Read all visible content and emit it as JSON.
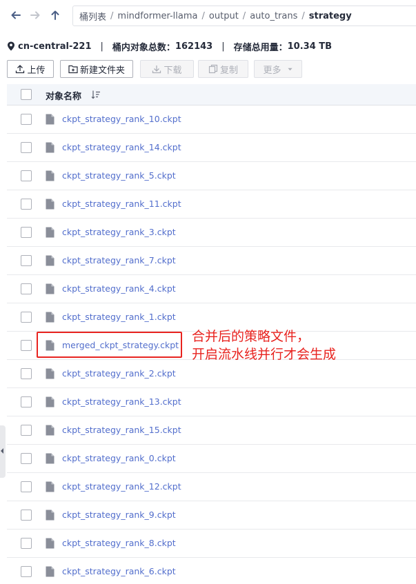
{
  "nav": {
    "back_icon": "arrow-left-icon",
    "forward_icon": "arrow-right-icon",
    "up_icon": "arrow-up-icon",
    "breadcrumbs": [
      "桶列表",
      "mindformer-llama",
      "output",
      "auto_trans",
      "strategy"
    ]
  },
  "info": {
    "region": "cn-central-221",
    "object_count_label": "桶内对象总数：",
    "object_count": "162143",
    "storage_label": "存储总用量：",
    "storage": "10.34 TB"
  },
  "toolbar": {
    "upload": "上传",
    "new_folder": "新建文件夹",
    "download": "下载",
    "copy": "复制",
    "more": "更多"
  },
  "table": {
    "header_name": "对象名称",
    "rows": [
      "ckpt_strategy_rank_10.ckpt",
      "ckpt_strategy_rank_14.ckpt",
      "ckpt_strategy_rank_5.ckpt",
      "ckpt_strategy_rank_11.ckpt",
      "ckpt_strategy_rank_3.ckpt",
      "ckpt_strategy_rank_7.ckpt",
      "ckpt_strategy_rank_4.ckpt",
      "ckpt_strategy_rank_1.ckpt",
      "merged_ckpt_strategy.ckpt",
      "ckpt_strategy_rank_2.ckpt",
      "ckpt_strategy_rank_13.ckpt",
      "ckpt_strategy_rank_15.ckpt",
      "ckpt_strategy_rank_0.ckpt",
      "ckpt_strategy_rank_12.ckpt",
      "ckpt_strategy_rank_9.ckpt",
      "ckpt_strategy_rank_8.ckpt",
      "ckpt_strategy_rank_6.ckpt"
    ]
  },
  "annotation": {
    "line1": "合并后的策略文件，",
    "line2": "开启流水线并行才会生成",
    "color": "#e8231f"
  },
  "colors": {
    "link": "#526ecc",
    "header_bg": "#f3f6fa",
    "icon_gray": "#8a8e99"
  }
}
